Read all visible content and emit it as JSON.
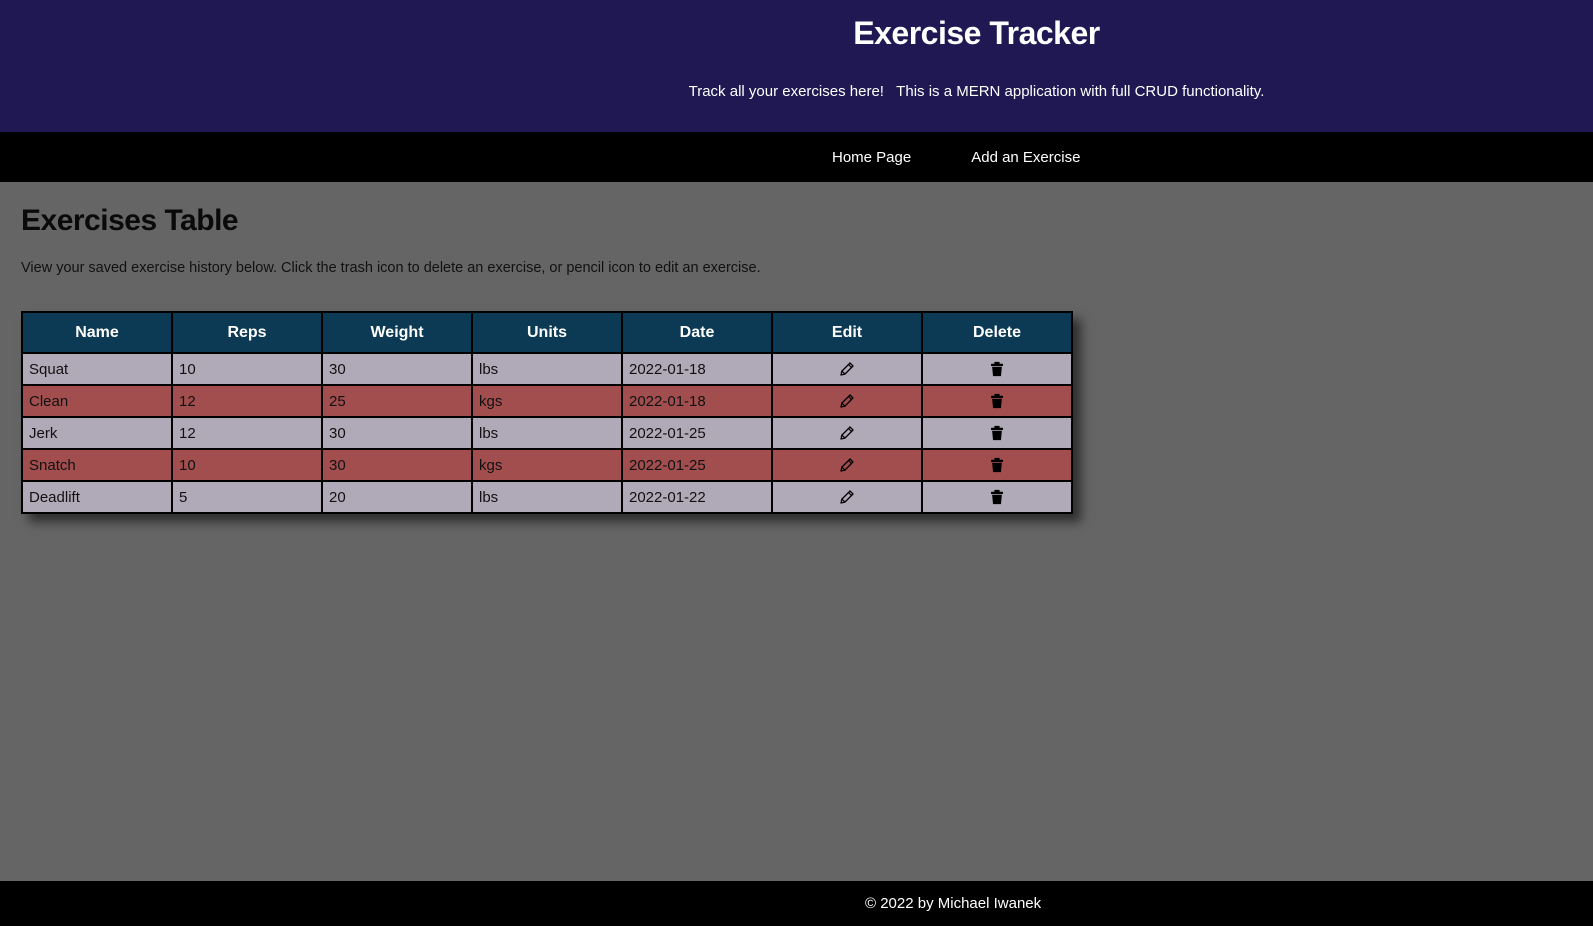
{
  "header": {
    "title": "Exercise Tracker",
    "tagline": "Track all your exercises here!   This is a MERN application with full CRUD functionality."
  },
  "nav": {
    "items": [
      {
        "label": "Home Page"
      },
      {
        "label": "Add an Exercise"
      }
    ]
  },
  "main": {
    "title": "Exercises Table",
    "intro": "View your saved exercise history below. Click the trash icon to delete an exercise, or pencil icon to edit an exercise."
  },
  "table": {
    "columns": [
      "Name",
      "Reps",
      "Weight",
      "Units",
      "Date",
      "Edit",
      "Delete"
    ],
    "rows": [
      {
        "name": "Squat",
        "reps": "10",
        "weight": "30",
        "units": "lbs",
        "date": "2022-01-18",
        "edit_icon": "pencil-icon",
        "delete_icon": "trash-icon"
      },
      {
        "name": "Clean",
        "reps": "12",
        "weight": "25",
        "units": "kgs",
        "date": "2022-01-18",
        "edit_icon": "pencil-icon",
        "delete_icon": "trash-icon"
      },
      {
        "name": "Jerk",
        "reps": "12",
        "weight": "30",
        "units": "lbs",
        "date": "2022-01-25",
        "edit_icon": "pencil-icon",
        "delete_icon": "trash-icon"
      },
      {
        "name": "Snatch",
        "reps": "10",
        "weight": "30",
        "units": "kgs",
        "date": "2022-01-25",
        "edit_icon": "pencil-icon",
        "delete_icon": "trash-icon"
      },
      {
        "name": "Deadlift",
        "reps": "5",
        "weight": "20",
        "units": "lbs",
        "date": "2022-01-22",
        "edit_icon": "pencil-icon",
        "delete_icon": "trash-icon"
      }
    ]
  },
  "footer": {
    "text": "© 2022 by Michael Iwanek"
  },
  "colors": {
    "header_bg": "#201852",
    "nav_bg": "#000000",
    "page_bg": "#656565",
    "table_header_bg": "#0c3a54",
    "row_light": "#b0aab8",
    "row_dark": "#a24e4f"
  }
}
